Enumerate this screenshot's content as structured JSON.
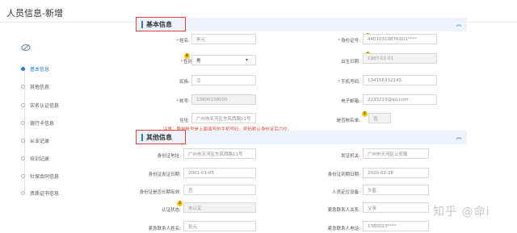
{
  "page": {
    "title": "人员信息-新增"
  },
  "sidebar": {
    "items": [
      {
        "label": "基本信息",
        "active": true
      },
      {
        "label": "其他信息",
        "active": false
      },
      {
        "label": "实名认证信息",
        "active": false
      },
      {
        "label": "银行卡信息",
        "active": false
      },
      {
        "label": "从业记录",
        "active": false
      },
      {
        "label": "培训记录",
        "active": false
      },
      {
        "label": "社保合同信息",
        "active": false
      },
      {
        "label": "资质证书信息",
        "active": false
      }
    ]
  },
  "basic": {
    "title": "基本信息",
    "name_label": "姓名:",
    "name_value": "李元",
    "id_label": "身份证号:",
    "id_value": "440103198701O1****",
    "gender_label": "性别:",
    "gender_value": "男",
    "birth_label": "出生日期:",
    "birth_value": "1987-01-01",
    "nation_label": "民族:",
    "nation_value": "汉",
    "phone_label": "手机号码:",
    "phone_value": "13415633214S",
    "account_label": "帐号:",
    "account_value": "13800138000",
    "email_label": "电子邮箱:",
    "email_value": "2233223@qq.com",
    "address_label": "住址:",
    "address_value": "广州市天河区东风西路11号",
    "gov_label": "是否帐名单:",
    "gov_value": "否",
    "warning": "注意：登录帐号是上面填写的手机号码，密码默认身份证后六位。"
  },
  "other": {
    "title": "其他信息",
    "idaddr_label": "身份证地址:",
    "idaddr_value": "广州市天河区东风西路11号",
    "issuer_label": "发证机关:",
    "issuer_value": "广州市天河区公安局",
    "issue_date_label": "身份证发证日期:",
    "issue_date_value": "2001-01-05",
    "expire_date_label": "身份证到期日期:",
    "expire_date_value": "2020-02-28",
    "longterm_label": "身份证是否长期有效:",
    "longterm_value": "否",
    "position_label": "人员定位设备:",
    "position_value": "头盔",
    "auth_label": "认证状态:",
    "auth_value": "未认证",
    "contact_rel_label": "紧急联系人关系:",
    "contact_rel_value": "父亲",
    "contact_name_label": "紧急联系人姓名:",
    "contact_name_value": "张元",
    "contact_phone_label": "紧急联系人电话:",
    "contact_phone_value": "1380013****"
  },
  "badges": [
    "1",
    "2",
    "3",
    "4",
    "5"
  ],
  "watermark": "知乎 @命i"
}
